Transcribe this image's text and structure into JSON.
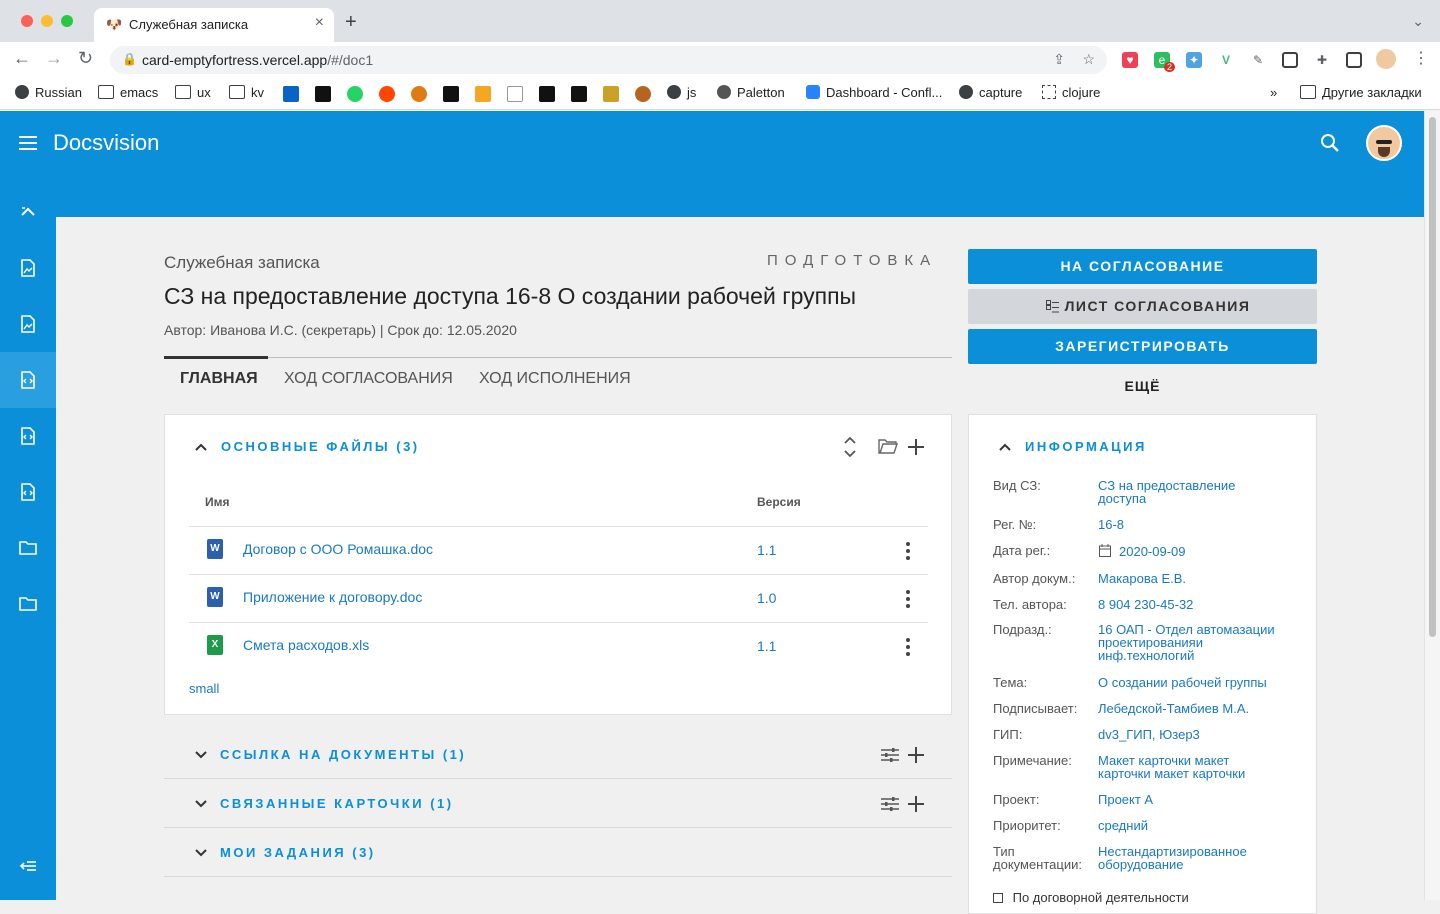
{
  "browser": {
    "tab_title": "Служебная записка",
    "url_host": "card-emptyfortress.vercel.app",
    "url_path": "/#/doc1",
    "bookmarks": [
      "Russian",
      "emacs",
      "ux",
      "kv",
      "js",
      "Paletton",
      "Dashboard - Confl...",
      "capture",
      "clojure"
    ],
    "other_bookmarks": "Другие закладки",
    "more_bookmarks": "»",
    "ext_badge": "2"
  },
  "app": {
    "brand": "Docsvision",
    "accent_color": "#0b8fd8"
  },
  "document": {
    "type": "Служебная записка",
    "stage": "ПОДГОТОВКА",
    "title": "СЗ на предоставление доступа 16-8 О создании рабочей группы",
    "meta": "Автор: Иванова И.С. (секретарь) | Срок до: 12.05.2020"
  },
  "tabs": [
    "ГЛАВНАЯ",
    "ХОД СОГЛАСОВАНИЯ",
    "ХОД ИСПОЛНЕНИЯ"
  ],
  "files": {
    "heading": "ОСНОВНЫЕ ФАЙЛЫ (3)",
    "col_name": "Имя",
    "col_version": "Версия",
    "rows": [
      {
        "name": "Договор с ООО Ромашка.doc",
        "version": "1.1",
        "kind": "word"
      },
      {
        "name": "Приложение к договору.doc",
        "version": "1.0",
        "kind": "word"
      },
      {
        "name": "Смета расходов.xls",
        "version": "1.1",
        "kind": "excel"
      }
    ],
    "small_link": "small"
  },
  "sections": [
    {
      "heading": "ССЫЛКА НА ДОКУМЕНТЫ (1)"
    },
    {
      "heading": "СВЯЗАННЫЕ КАРТОЧКИ (1)"
    },
    {
      "heading": "МОИ ЗАДАНИЯ (3)"
    }
  ],
  "actions": {
    "send": "НА СОГЛАСОВАНИЕ",
    "sheet": "ЛИСТ СОГЛАСОВАНИЯ",
    "register": "ЗАРЕГИСТРИРОВАТЬ",
    "more": "ЕЩЁ"
  },
  "info": {
    "heading": "ИНФОРМАЦИЯ",
    "rows": [
      {
        "label": "Вид СЗ:",
        "value": "СЗ на предоставление доступа"
      },
      {
        "label": "Рег. №:",
        "value": "16-8"
      },
      {
        "label": "Дата рег.:",
        "value": "2020-09-09"
      },
      {
        "label": "Автор докум.:",
        "value": "Макарова Е.В."
      },
      {
        "label": "Тел. автора:",
        "value": "8 904 230-45-32"
      },
      {
        "label": "Подразд.:",
        "value": "16 ОАП - Отдел автомазации проектированияи инф.технологий"
      },
      {
        "label": "Тема:",
        "value": "О создании рабочей группы"
      },
      {
        "label": "Подписывает:",
        "value": "Лебедской-Тамбиев М.А."
      },
      {
        "label": "ГИП:",
        "value": "dv3_ГИП, Юзер3"
      },
      {
        "label": "Примечание:",
        "value": "Макет карточки макет карточки макет карточки"
      },
      {
        "label": "Проект:",
        "value": "Проект А"
      },
      {
        "label": "Приоритет:",
        "value": "средний"
      },
      {
        "label": "Тип документации:",
        "value": "Нестандартизированное оборудование"
      }
    ],
    "checkbox_label": "По договорной деятельности"
  }
}
